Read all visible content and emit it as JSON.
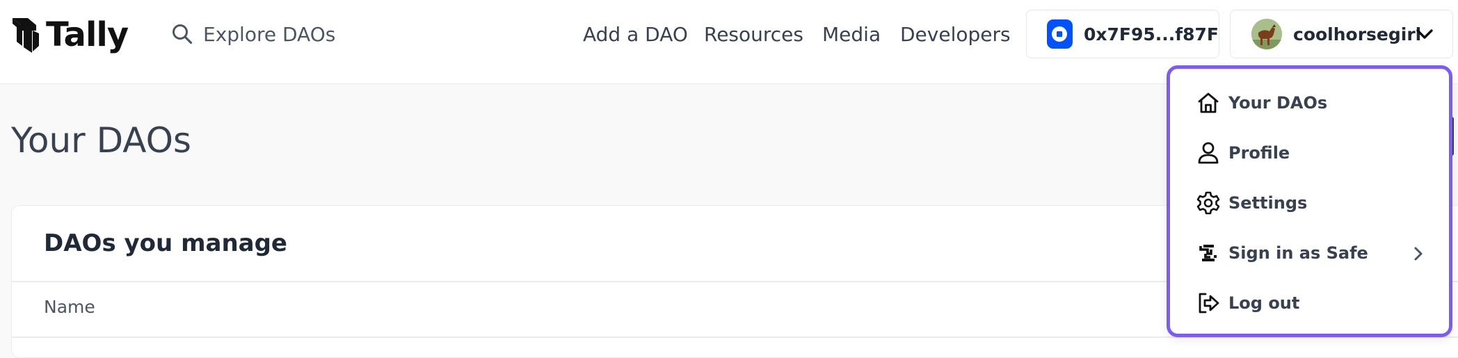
{
  "header": {
    "logo_text": "Tally",
    "explore_label": "Explore DAOs",
    "nav": {
      "add_dao": "Add a DAO",
      "resources": "Resources",
      "media": "Media",
      "developers": "Developers"
    },
    "wallet_address": "0x7F95...f87F",
    "username": "coolhorsegirl"
  },
  "main": {
    "page_title": "Your DAOs",
    "card_title": "DAOs you manage",
    "column_name": "Name"
  },
  "dropdown": {
    "items": [
      {
        "label": "Your DAOs",
        "icon": "home-icon"
      },
      {
        "label": "Profile",
        "icon": "user-icon"
      },
      {
        "label": "Settings",
        "icon": "gear-icon"
      },
      {
        "label": "Sign in as Safe",
        "icon": "safe-icon"
      },
      {
        "label": "Log out",
        "icon": "logout-icon"
      }
    ]
  },
  "colors": {
    "accent_border": "#7c5cf5",
    "wallet_brand": "#0052ff"
  }
}
